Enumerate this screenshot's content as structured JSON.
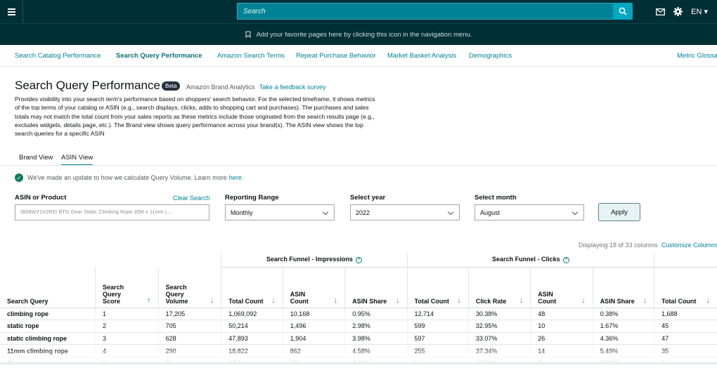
{
  "search": {
    "placeholder": "Search"
  },
  "header": {
    "language": "EN"
  },
  "favorites_bar": {
    "text": "Add your favorite pages here by clicking this icon in the navigation menu."
  },
  "nav": [
    "Search Catalog Performance",
    "Search Query Performance",
    "Amazon Search Terms",
    "Repeat Purchase Behavior",
    "Market Basket Analysis",
    "Demographics",
    "Metric Glossa"
  ],
  "page": {
    "title": "Search Query Performance",
    "badge": "Beta",
    "subtitle": "Amazon Brand Analytics",
    "survey_link": "Take a feedback survey",
    "description": "Provides visibility into your search term's performance based on shoppers' search behavior. For the selected timeframe, it shows metrics of the top terms of your catalog or ASIN (e.g., search displays, clicks, adds to shopping cart and purchases). The purchases and sales totals may not match the total count from your sales reports as these metrics include those originated from the search results page (e.g., excludes widgets, details page, etc.). The Brand view shows query performance across your brand(s). The ASIN view shows the top search queries for a specific ASIN"
  },
  "tabs": [
    "Brand View",
    "ASIN View"
  ],
  "notice": {
    "text": "We've made an update to how we calculate Query Volume. Learn more",
    "link": "here."
  },
  "filters": {
    "asin_label": "ASIN or Product",
    "clear_label": "Clear Search",
    "asin_value": "(B08WY1V2R6) RTG Gear Static Climbing Rope 30M x 11mm L...",
    "range_label": "Reporting Range",
    "range_value": "Monthly",
    "year_label": "Select year",
    "year_value": "2022",
    "month_label": "Select month",
    "month_value": "August",
    "apply_label": "Apply"
  },
  "table_meta": {
    "displaying": "Displaying 18 of 33 columns",
    "customize": "Customize Columns"
  },
  "table": {
    "groups": [
      "Search Funnel - Impressions",
      "Search Funnel - Clicks"
    ],
    "columns": [
      "Search Query",
      "Search Query Score",
      "Search Query Volume",
      "Total Count",
      "ASIN Count",
      "ASIN Share",
      "Total Count",
      "Click Rate",
      "ASIN Count",
      "ASIN Share",
      "Total Count"
    ],
    "rows": [
      [
        "climbing rope",
        "1",
        "17,205",
        "1,069,092",
        "10,168",
        "0.95%",
        "12,714",
        "30.38%",
        "48",
        "0.38%",
        "1,688"
      ],
      [
        "static rope",
        "2",
        "705",
        "50,214",
        "1,496",
        "2.98%",
        "599",
        "32.95%",
        "10",
        "1.67%",
        "45"
      ],
      [
        "static climbing rope",
        "3",
        "628",
        "47,893",
        "1,904",
        "3.98%",
        "597",
        "33.07%",
        "26",
        "4.36%",
        "47"
      ],
      [
        "11mm climbing rope",
        "4",
        "290",
        "18,822",
        "862",
        "4.58%",
        "255",
        "37.34%",
        "14",
        "5.49%",
        "35"
      ],
      [
        "11mm rope",
        "5",
        "74",
        "4,544",
        "221",
        "4.86%",
        "54",
        "32.14%",
        "7",
        "12.96%",
        "7"
      ]
    ]
  }
}
